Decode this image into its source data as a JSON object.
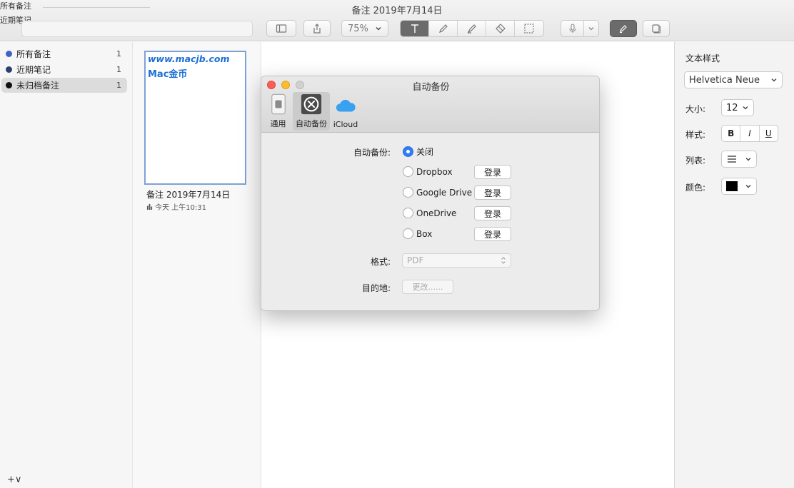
{
  "window": {
    "title": "备注 2019年7月14日",
    "ghost_line1": "所有备注",
    "ghost_line2": "近期笔记"
  },
  "toolbar": {
    "zoom_value": "75%",
    "icons": [
      "sidebar-toggle-icon",
      "share-icon",
      "text-tool-icon",
      "pen-icon",
      "highlighter-icon",
      "eraser-icon",
      "selection-icon",
      "microphone-icon",
      "dropdown-icon",
      "marker-icon",
      "page-icon"
    ]
  },
  "sidebar": {
    "items": [
      {
        "label": "所有备注",
        "count": "1",
        "color": "#3b63c8"
      },
      {
        "label": "近期笔记",
        "count": "1",
        "color": "#2d3f6e"
      },
      {
        "label": "未归档备注",
        "count": "1",
        "color": "#111111"
      }
    ],
    "add_label": "+∨"
  },
  "note": {
    "thumb_line1": "www.macjb.com",
    "thumb_line2": "Mac金币",
    "title": "备注 2019年7月14日",
    "meta": "今天 上午10:31"
  },
  "inspector": {
    "heading": "文本样式",
    "font": "Helvetica Neue",
    "size_label": "大小:",
    "size_value": "12",
    "style_label": "样式:",
    "bold": "B",
    "italic": "I",
    "underline": "U",
    "list_label": "列表:",
    "color_label": "颜色:",
    "color_value": "#000000"
  },
  "dialog": {
    "title": "自动备份",
    "tabs": [
      {
        "label": "通用"
      },
      {
        "label": "自动备份"
      },
      {
        "label": "iCloud"
      }
    ],
    "backup_label": "自动备份:",
    "options": [
      {
        "label": "关闭",
        "checked": true
      },
      {
        "label": "Dropbox",
        "checked": false,
        "button": "登录"
      },
      {
        "label": "Google Drive",
        "checked": false,
        "button": "登录"
      },
      {
        "label": "OneDrive",
        "checked": false,
        "button": "登录"
      },
      {
        "label": "Box",
        "checked": false,
        "button": "登录"
      }
    ],
    "format_label": "格式:",
    "format_value": "PDF",
    "destination_label": "目的地:",
    "change_button": "更改......"
  }
}
